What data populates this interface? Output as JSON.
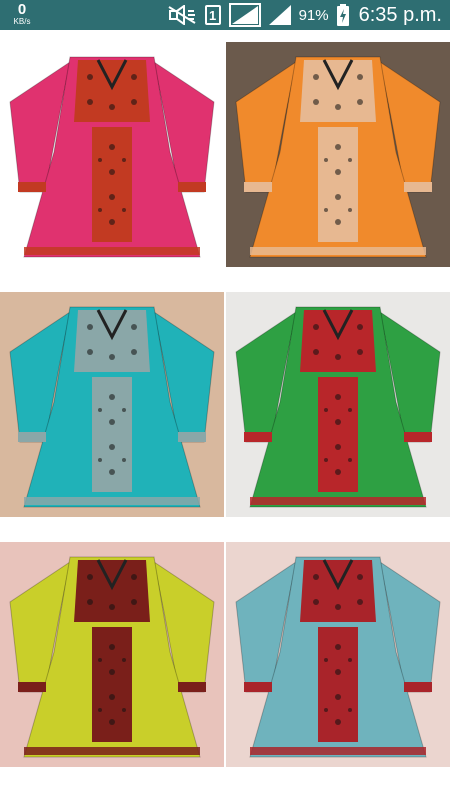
{
  "status_bar": {
    "net_speed_value": "0",
    "net_speed_unit": "KB/s",
    "battery_percent": "91%",
    "time": "6:35 p.m.",
    "sim_label": "1",
    "background_color": "#2e6e72",
    "icons": [
      "mute-icon",
      "sim-icon",
      "signal-icon",
      "signal-icon-2",
      "battery-charging-icon"
    ]
  },
  "gallery": {
    "items": [
      {
        "name": "pink-embroidered-dress",
        "background": "#ffffff",
        "dress_color": "#e0326f",
        "panel_color": "#c23a22"
      },
      {
        "name": "orange-embroidered-dress",
        "background": "#6b5a4c",
        "dress_color": "#f08a2c",
        "panel_color": "#e7b891"
      },
      {
        "name": "turquoise-embroidered-dress",
        "background": "#d8b89e",
        "dress_color": "#20b2b8",
        "panel_color": "#8aa7a8"
      },
      {
        "name": "green-embroidered-dress",
        "background": "#e9e8e6",
        "dress_color": "#2ea043",
        "panel_color": "#b8262a"
      },
      {
        "name": "yellow-embroidered-dress",
        "background": "#e8c3bb",
        "dress_color": "#c9cf2a",
        "panel_color": "#7a1f1a"
      },
      {
        "name": "lightblue-embroidered-dress",
        "background": "#ebd5cf",
        "dress_color": "#6fb3bd",
        "panel_color": "#a9242a"
      }
    ]
  }
}
